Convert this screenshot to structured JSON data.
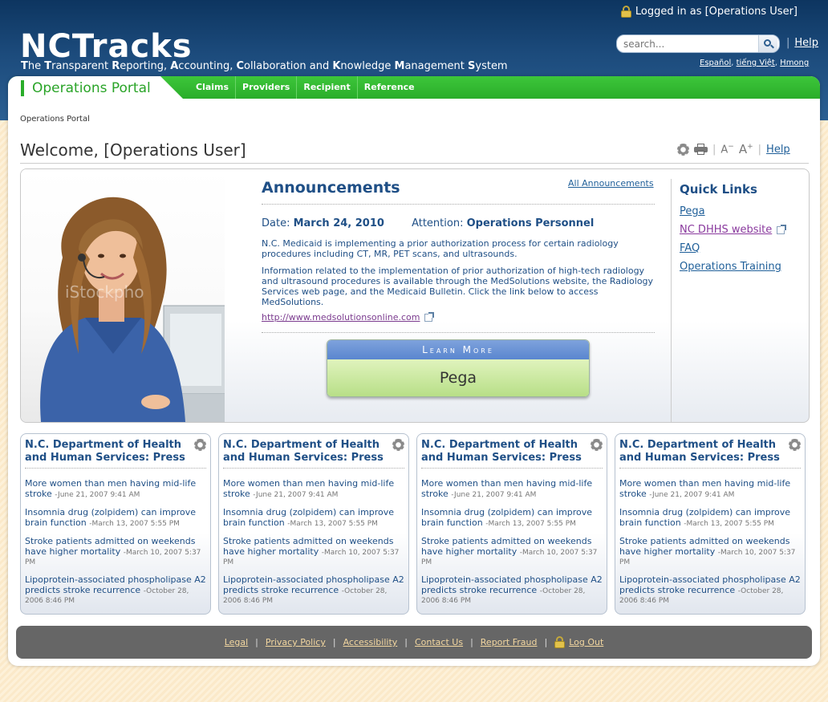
{
  "header": {
    "logged_in": "Logged in as [Operations User]",
    "brand": "NCTracks",
    "tagline_parts": [
      {
        "b": "T",
        "t": "he "
      },
      {
        "b": "T",
        "t": "ransparent "
      },
      {
        "b": "R",
        "t": "eporting, "
      },
      {
        "b": "A",
        "t": "ccounting, "
      },
      {
        "b": "C",
        "t": "ollaboration and "
      },
      {
        "b": "K",
        "t": "nowledge "
      },
      {
        "b": "M",
        "t": "anagement "
      },
      {
        "b": "S",
        "t": "ystem"
      }
    ],
    "search_placeholder": "search...",
    "help": "Help",
    "languages": [
      "Español",
      "tiếng Việt",
      "Hmong"
    ]
  },
  "nav": {
    "portal_title": "Operations Portal",
    "items": [
      "Claims",
      "Providers",
      "Recipient",
      "Reference"
    ]
  },
  "breadcrumb": "Operations Portal",
  "page_title": "Welcome, [Operations User]",
  "tools": {
    "font_small": "A",
    "font_large": "A",
    "help": "Help"
  },
  "announcements": {
    "heading": "Announcements",
    "all_link": "All Announcements",
    "date_label": "Date:",
    "date": "March 24, 2010",
    "attention_label": "Attention:",
    "attention": "Operations Personnel",
    "p1": "N.C. Medicaid is implementing a prior authorization process for certain radiology procedures including CT, MR, PET scans, and ultrasounds.",
    "p2": "Information related to the implementation of prior authorization of high-tech radiology and ultrasound procedures is available through the MedSolutions website, the Radiology Services web page, and the Medicaid Bulletin. Click the link below to access MedSolutions.",
    "link": "http://www.medsolutionsonline.com",
    "learn_more": "Learn More",
    "learn_more_target": "Pega"
  },
  "photo": {
    "watermark": "iStockpho"
  },
  "quick_links": {
    "heading": "Quick Links",
    "items": [
      "Pega",
      "NC DHHS website",
      "FAQ",
      "Operations Training"
    ]
  },
  "press": {
    "heading": "N.C. Department of Health and Human Services: Press",
    "items": [
      {
        "title": "More women than men having mid-life stroke",
        "date": "-June 21, 2007 9:41 AM"
      },
      {
        "title": "Insomnia drug (zolpidem) can improve brain function",
        "date": "-March 13, 2007 5:55 PM"
      },
      {
        "title": "Stroke patients admitted on weekends have higher mortality",
        "date": "-March 10, 2007 5:37 PM"
      },
      {
        "title": "Lipoprotein-associated phospholipase A2 predicts stroke recurrence",
        "date": "-October 28, 2006 8:46 PM"
      }
    ]
  },
  "footer": {
    "links": [
      "Legal",
      "Privacy Policy",
      "Accessibility",
      "Contact Us",
      "Report Fraud"
    ],
    "logout": "Log Out"
  },
  "colors": {
    "header_dark": "#0d3560",
    "nav_green": "#2aad2a",
    "title_blue": "#1f4f86",
    "footer_gray": "#666666"
  }
}
